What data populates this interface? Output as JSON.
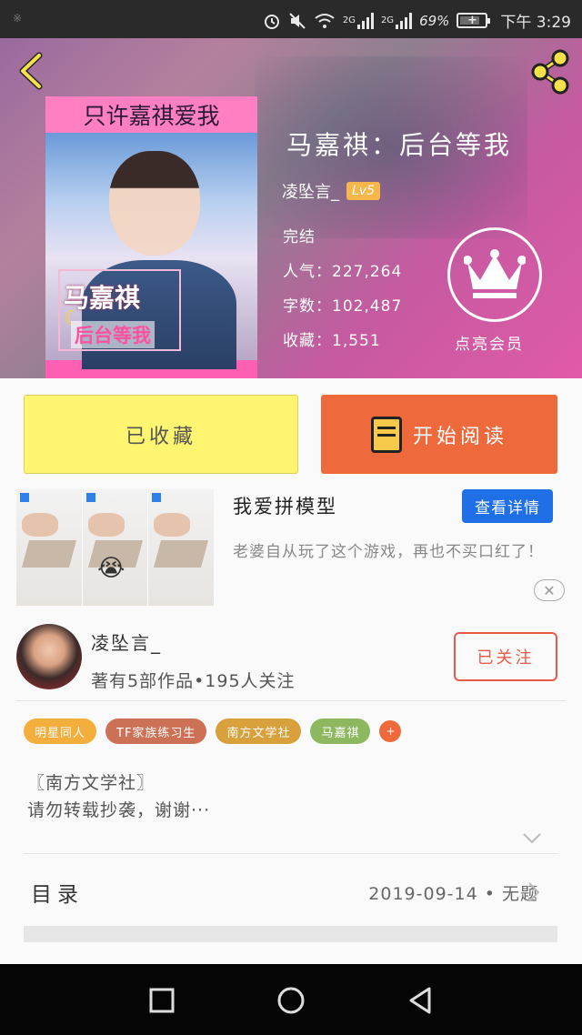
{
  "status_bar": {
    "network_1": "2G",
    "network_2": "2G",
    "battery": "69%",
    "time": "下午 3:29",
    "icons": [
      "alarm-icon",
      "mute-icon",
      "wifi-icon",
      "signal-icon",
      "battery-icon"
    ]
  },
  "header": {
    "back_icon": "chevron-left-icon",
    "share_icon": "share-icon"
  },
  "book": {
    "title": "马嘉祺：后台等我",
    "author": "凌坠言_",
    "level": "Lv5",
    "status": "完结",
    "popularity": "人气：227,264",
    "word_count": "字数：102,487",
    "favorites": "收藏：1,551",
    "cover_text_top": "只许嘉祺爱我",
    "cover_text_name": "马嘉祺",
    "cover_text_sub": "后台等我"
  },
  "vip": {
    "label": "点亮会员",
    "icon": "crown-icon"
  },
  "actions": {
    "collected": "已收藏",
    "start_reading": "开始阅读"
  },
  "ad": {
    "title": "我爱拼模型",
    "detail_button": "查看详情",
    "description": "老婆自从玩了这个游戏，再也不买口红了！",
    "emoji": "😭"
  },
  "author_card": {
    "name": "凌坠言_",
    "meta": "著有5部作品•195人关注",
    "follow_button": "已关注"
  },
  "tags": [
    {
      "label": "明星同人",
      "color": "#f4ae3c"
    },
    {
      "label": "TF家族练习生",
      "color": "#cd7156"
    },
    {
      "label": "南方文学社",
      "color": "#d8a13c"
    },
    {
      "label": "马嘉祺",
      "color": "#8db860"
    }
  ],
  "tag_add": "+",
  "intro": {
    "line1": "〖南方文学社〗",
    "line2": "请勿转载抄袭，谢谢···"
  },
  "toc": {
    "label": "目录",
    "latest": "2019-09-14 • 无题"
  },
  "colors": {
    "accent_orange": "#ee6a3c",
    "collected_yellow": "#fff570",
    "ad_blue": "#1f6fe6",
    "follow_red": "#e75a4a"
  }
}
